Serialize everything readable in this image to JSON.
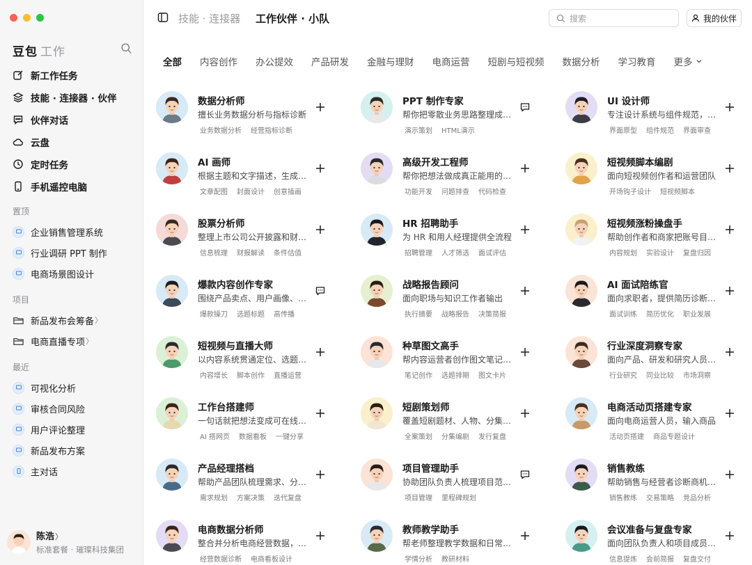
{
  "sidebar": {
    "brand": "豆包",
    "brand_sub": "工作",
    "nav": [
      {
        "label": "新工作任务",
        "icon": "edit-icon"
      },
      {
        "label": "技能 · 连接器 · 伙伴",
        "icon": "layers-icon"
      },
      {
        "label": "伙伴对话",
        "icon": "chat-icon"
      },
      {
        "label": "云盘",
        "icon": "cloud-icon"
      },
      {
        "label": "定时任务",
        "icon": "clock-icon"
      },
      {
        "label": "手机遥控电脑",
        "icon": "phone-icon"
      }
    ],
    "pinned_label": "置顶",
    "pinned": [
      "企业销售管理系统",
      "行业调研 PPT 制作",
      "电商场景图设计"
    ],
    "projects_label": "项目",
    "projects": [
      "新品发布会筹备",
      "电商直播专项"
    ],
    "recent_label": "最近",
    "recent": [
      "可视化分析",
      "审核合同风险",
      "用户评论整理",
      "新品发布方案",
      "主对话"
    ],
    "user": {
      "name": "陈浩",
      "plan": "标准套餐 · 璀璨科技集团"
    }
  },
  "header": {
    "crumb": "技能 · 连接器",
    "title": "工作伙伴 · 小队",
    "search_placeholder": "搜索",
    "my_partner": "我的伙伴"
  },
  "tabs": [
    "全部",
    "内容创作",
    "办公提效",
    "产品研发",
    "金融与理财",
    "电商运营",
    "短剧与短视频",
    "数据分析",
    "学习教育",
    "更多"
  ],
  "colors": {
    "accent_bg": "#e3eefc"
  },
  "cards": [
    {
      "title": "数据分析师",
      "desc": "擅长业务数据分析与指标诊断",
      "tags": [
        "业务数据分析",
        "经营指标诊断"
      ],
      "action": "plus",
      "bg": "#d7eaf5",
      "hair": "#3a2a20",
      "shirt": "#6c7a89"
    },
    {
      "title": "PPT 制作专家",
      "desc": "帮你把零散业务思路整理成演示",
      "tags": [
        "演示策划",
        "HTML演示"
      ],
      "action": "chat",
      "bg": "#d6f0ef",
      "hair": "#2b2b2b",
      "shirt": "#e9e9ea"
    },
    {
      "title": "UI 设计师",
      "desc": "专注设计系统与组件规范，打磨",
      "tags": [
        "界面原型",
        "组件规范",
        "界面审查"
      ],
      "action": "plus",
      "bg": "#e4dcf5",
      "hair": "#1e1e22",
      "shirt": "#3c3c44"
    },
    {
      "title": "AI 画师",
      "desc": "根据主题和文字描述，生成高质",
      "tags": [
        "文章配图",
        "封面设计",
        "创意插画"
      ],
      "action": "plus",
      "bg": "#d7eaf5",
      "hair": "#3a2418",
      "shirt": "#c04040"
    },
    {
      "title": "高级开发工程师",
      "desc": "帮你把想法做成真正能用的产品",
      "tags": [
        "功能开发",
        "问题排查",
        "代码检查"
      ],
      "action": "plus",
      "bg": "#e4dcf5",
      "hair": "#2a2a2e",
      "shirt": "#dcdce0"
    },
    {
      "title": "短视频脚本编剧",
      "desc": "面向短视频创作者和运营团队",
      "tags": [
        "开场钩子设计",
        "短视频脚本"
      ],
      "action": "plus",
      "bg": "#fbf0cc",
      "hair": "#4a2f1e",
      "shirt": "#e3a34a"
    },
    {
      "title": "股票分析师",
      "desc": "整理上市公司公开披露和财务数据",
      "tags": [
        "信息梳理",
        "财报解读",
        "条件估值"
      ],
      "action": "plus",
      "bg": "#f5dada",
      "hair": "#3a2a20",
      "shirt": "#4a4a50"
    },
    {
      "title": "HR 招聘助手",
      "desc": "为 HR 和用人经理提供全流程",
      "tags": [
        "招聘管理",
        "人才筛选",
        "面试评估"
      ],
      "action": "plus",
      "bg": "#d7eaf5",
      "hair": "#1a1a1e",
      "shirt": "#22262c"
    },
    {
      "title": "短视频涨粉操盘手",
      "desc": "帮助创作者和商家把账号目标拆",
      "tags": [
        "内容规划",
        "实验设计",
        "复盘归因"
      ],
      "action": "plus",
      "bg": "#fbf0cc",
      "hair": "#c8a070",
      "shirt": "#f2f2f2"
    },
    {
      "title": "爆款内容创作专家",
      "desc": "围绕产品卖点、用户画像、平台",
      "tags": [
        "爆款操刀",
        "选题标题",
        "高传播"
      ],
      "action": "chat",
      "bg": "#d7eaf5",
      "hair": "#1e1e22",
      "shirt": "#3c4a5a"
    },
    {
      "title": "战略报告顾问",
      "desc": "面向职场与知识工作者输出",
      "tags": [
        "执行摘要",
        "战略报告",
        "决策简报"
      ],
      "action": "plus",
      "bg": "#e6efcf",
      "hair": "#2a1e16",
      "shirt": "#7a4a2e"
    },
    {
      "title": "AI 面试陪练官",
      "desc": "面向求职者，提供简历诊断和模",
      "tags": [
        "面试训练",
        "简历优化",
        "职业发展"
      ],
      "action": "plus",
      "bg": "#fbe3d6",
      "hair": "#1a1a1e",
      "shirt": "#2a2a2e"
    },
    {
      "title": "短视频与直播大师",
      "desc": "以内容系统贯通定位、选题与直",
      "tags": [
        "内容增长",
        "脚本创作",
        "直播运营"
      ],
      "action": "plus",
      "bg": "#dcf0d6",
      "hair": "#2a2a2e",
      "shirt": "#4a9a6a"
    },
    {
      "title": "种草图文高手",
      "desc": "帮内容运营者创作图文笔记内容",
      "tags": [
        "笔记创作",
        "选题排期",
        "图文卡片"
      ],
      "action": "plus",
      "bg": "#fbe3d6",
      "hair": "#2a2a2e",
      "shirt": "#e8e8ea"
    },
    {
      "title": "行业深度洞察专家",
      "desc": "面向产品、研发和研究人员提供",
      "tags": [
        "行业研究",
        "同业比较",
        "市场洞察"
      ],
      "action": "plus",
      "bg": "#fbe3d6",
      "hair": "#3a2a20",
      "shirt": "#6a4a3a"
    },
    {
      "title": "工作台搭建师",
      "desc": "一句话就把想法变成可在线使用",
      "tags": [
        "AI 搭网页",
        "数据看板",
        "一键分享"
      ],
      "action": "plus",
      "bg": "#dcf0d6",
      "hair": "#3a2418",
      "shirt": "#e8d8b0"
    },
    {
      "title": "短剧策划师",
      "desc": "覆盖短剧题材、人物、分集与节奏",
      "tags": [
        "全案策划",
        "分集编剧",
        "发行复盘"
      ],
      "action": "plus",
      "bg": "#fbf0cc",
      "hair": "#2a1e16",
      "shirt": "#f2e6d0"
    },
    {
      "title": "电商活动页搭建专家",
      "desc": "面向电商运营人员，输入商品",
      "tags": [
        "活动页搭建",
        "商品专题设计"
      ],
      "action": "plus",
      "bg": "#d7eaf5",
      "hair": "#4a3020",
      "shirt": "#c89a6a"
    },
    {
      "title": "产品经理搭档",
      "desc": "帮助产品团队梳理需求、分析竞",
      "tags": [
        "需求规划",
        "方案决策",
        "迭代复盘"
      ],
      "action": "plus",
      "bg": "#d7eaf5",
      "hair": "#2a2a2e",
      "shirt": "#4a6a8a"
    },
    {
      "title": "项目管理助手",
      "desc": "协助团队负责人梳理项目范围与",
      "tags": [
        "项目管理",
        "里程碑规划"
      ],
      "action": "chat",
      "bg": "#fbe3d6",
      "hair": "#2a1e16",
      "shirt": "#e8e8ea"
    },
    {
      "title": "销售教练",
      "desc": "帮助销售与经营者诊断商机推进",
      "tags": [
        "销售教练",
        "交易策略",
        "竞品分析"
      ],
      "action": "plus",
      "bg": "#e4dcf5",
      "hair": "#1a1a1e",
      "shirt": "#3a5a4a"
    },
    {
      "title": "电商数据分析师",
      "desc": "整合并分析电商经营数据，输出",
      "tags": [
        "经营数据诊断",
        "电商看板设计"
      ],
      "action": "plus",
      "bg": "#e4dcf5",
      "hair": "#3a2418",
      "shirt": "#4a4a50"
    },
    {
      "title": "教师教学助手",
      "desc": "帮老师整理教学数据和日常工作",
      "tags": [
        "学情分析",
        "教研材料"
      ],
      "action": "plus",
      "bg": "#d7eaf5",
      "hair": "#2a2a2e",
      "shirt": "#5a6a4a"
    },
    {
      "title": "会议准备与复盘专家",
      "desc": "面向团队负责人和项目成员提供",
      "tags": [
        "信息提炼",
        "会前简报",
        "复盘交付"
      ],
      "action": "plus",
      "bg": "#d6f0ef",
      "hair": "#1a1a1e",
      "shirt": "#4a9a8a"
    }
  ]
}
